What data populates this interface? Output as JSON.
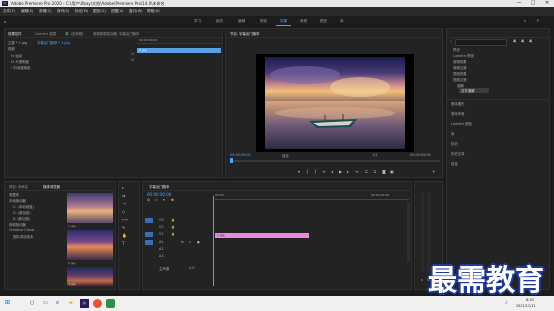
{
  "app": {
    "logo_text": "Pr",
    "title": "Adobe Premiere Pro 2020 - C:\\用户\\Xbay\\文档\\Adobe\\Premiere Pro\\14.0\\未命名",
    "window_controls": [
      "—",
      "□",
      "✕"
    ]
  },
  "menu": [
    "文件(F)",
    "编辑(E)",
    "剪辑(C)",
    "序列(S)",
    "标记(M)",
    "图形(G)",
    "视图(V)",
    "窗口(W)",
    "帮助(H)"
  ],
  "workspaces": [
    "学习",
    "组件",
    "编辑",
    "颜色",
    "效果",
    "音频",
    "图形",
    "库"
  ],
  "active_workspace": "效果",
  "effect_controls": {
    "tabs": [
      "效果控件",
      "Lumetri 范围",
      "源: (无剪辑)",
      "音频剪辑混合器: 字幕出门随享"
    ],
    "crumb": [
      "主要 * 1.jpg",
      "字幕出门随享 * 1.jpg"
    ],
    "section": "视频",
    "rows": [
      "fx 运动",
      "fx 不透明度",
      "› 时间重映射"
    ],
    "clip_name": "1.jpg",
    "timecode": "00:00:00:00"
  },
  "program_monitor": {
    "title": "节目: 字幕出门随享",
    "timecode_left": "00:00:00:00",
    "fit_label": "适合",
    "quality": "1/2",
    "timecode_right": "00:00:05:00"
  },
  "effects_panel": {
    "search_placeholder": "",
    "tree": [
      "预设",
      "Lumetri 预设",
      "音频效果",
      "音频过渡",
      "视频效果",
      "视频过渡",
      "溶解",
      "交叉溶解"
    ],
    "sections": [
      "基本图形",
      "基本声音",
      "Lumetri 颜色",
      "库",
      "标记",
      "历史记录",
      "信息"
    ]
  },
  "project_panel": {
    "tabs": [
      "项目: 未命名",
      "媒体浏览器"
    ],
    "tree": [
      "收藏夹",
      "本地驱动器",
      "C: (本地磁盘)",
      "D: (新加卷)",
      "E: (新加卷)",
      "网络驱动器",
      "Creative Cloud",
      "团队项目版本"
    ],
    "thumb_labels": [
      "1.jpg",
      "2.jpg",
      "3.jpg"
    ]
  },
  "timeline": {
    "title": "字幕出门随享",
    "timecode": "00:00:00:00",
    "ruler": [
      "00:00",
      "00:00:05:00"
    ],
    "tracks": [
      "V3",
      "V2",
      "V1",
      "A1",
      "A2",
      "A3"
    ],
    "master_label": "主声道",
    "master_value": "0.0",
    "clip_label": "1.jpg"
  },
  "taskbar": {
    "time": "8:52",
    "date": "2021/11/12"
  },
  "watermark": "最需教育",
  "colors": {
    "accent_blue": "#4da3ff",
    "clip_pink": "#e58ae0",
    "selection_blue": "#5aa0e6",
    "watermark_outline": "#1e3a9a"
  }
}
